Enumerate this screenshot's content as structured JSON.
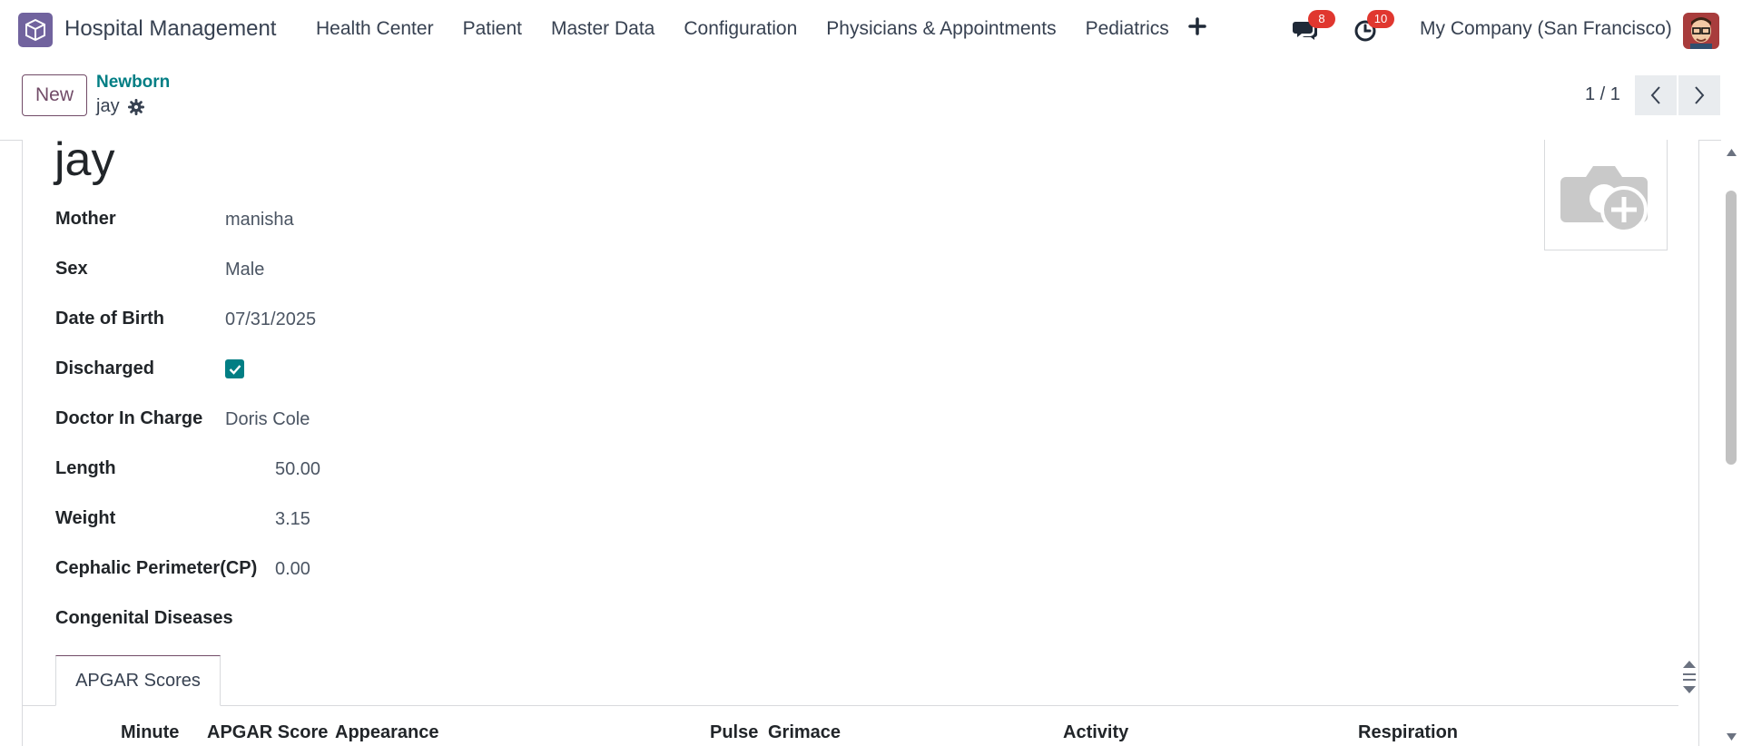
{
  "navbar": {
    "brand": "Hospital Management",
    "menu": [
      {
        "label": "Health Center"
      },
      {
        "label": "Patient"
      },
      {
        "label": "Master Data"
      },
      {
        "label": "Configuration"
      },
      {
        "label": "Physicians & Appointments"
      },
      {
        "label": "Pediatrics"
      }
    ],
    "messages_count": "8",
    "activities_count": "10",
    "company": "My Company (San Francisco)"
  },
  "control_panel": {
    "new_label": "New",
    "breadcrumb_parent": "Newborn",
    "breadcrumb_current": "jay",
    "pager": "1 / 1"
  },
  "form": {
    "title": "jay",
    "fields": {
      "mother": {
        "label": "Mother",
        "value": "manisha"
      },
      "sex": {
        "label": "Sex",
        "value": "Male"
      },
      "dob": {
        "label": "Date of Birth",
        "value": "07/31/2025"
      },
      "discharged": {
        "label": "Discharged",
        "checked": true
      },
      "doctor": {
        "label": "Doctor In Charge",
        "value": "Doris Cole"
      },
      "length": {
        "label": "Length",
        "value": "50.00"
      },
      "weight": {
        "label": "Weight",
        "value": "3.15"
      },
      "cp": {
        "label": "Cephalic Perimeter(CP)",
        "value": "0.00"
      },
      "congenital": {
        "label": "Congenital Diseases"
      }
    },
    "tab": "APGAR Scores",
    "columns": [
      "Minute",
      "APGAR Score",
      "Appearance",
      "Pulse",
      "Grimace",
      "Activity",
      "Respiration"
    ]
  },
  "colors": {
    "brand": "#714b67",
    "accent": "#017e84",
    "badge": "#e0372f"
  }
}
